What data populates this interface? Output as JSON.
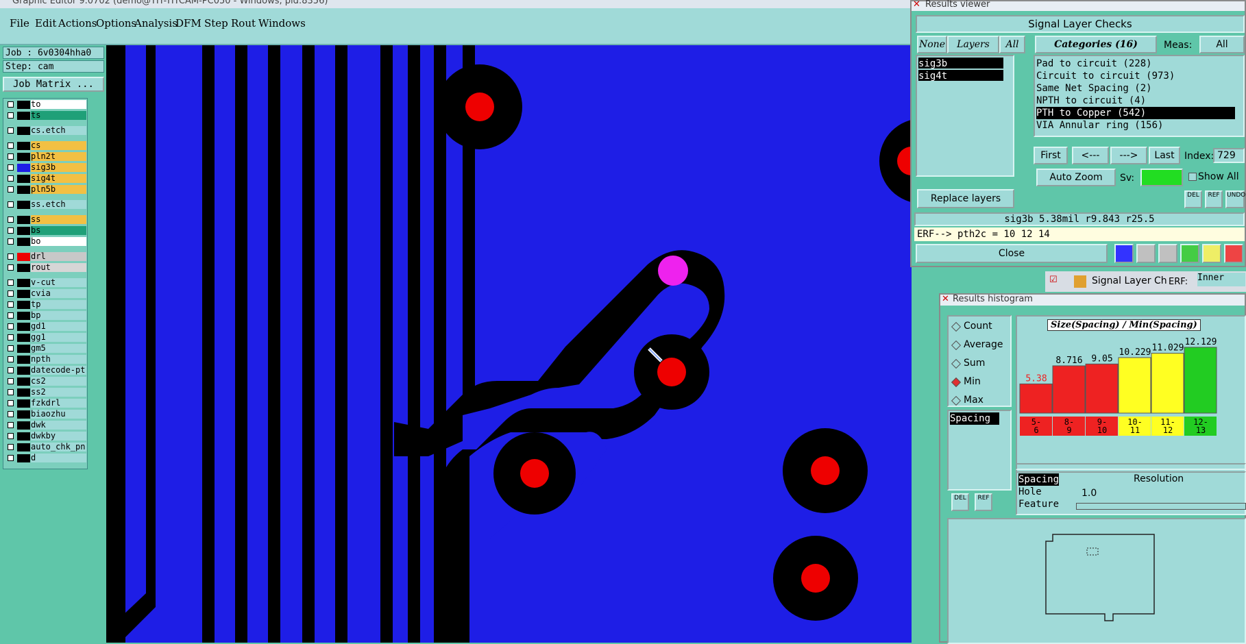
{
  "window": {
    "title": "Graphic Editor 9.0702 (demo@TIT-TITCAM-PC050 - Windows, pid:8356)"
  },
  "menu": [
    "File",
    "Edit",
    "Actions",
    "Options",
    "Analysis",
    "DFM",
    "Step",
    "Rout",
    "Windows"
  ],
  "job": {
    "job_label": "Job : 6v0304hha0",
    "step_label": "Step: cam",
    "matrix_button": "Job Matrix ..."
  },
  "layers": [
    {
      "name": "to",
      "color": "#000000",
      "bg": "#ffffff",
      "mark": "✎"
    },
    {
      "name": "ts",
      "color": "#000000",
      "bg": "#1fa078",
      "mark": ""
    },
    {
      "name": "cs.etch",
      "color": "#000000",
      "bg": "#a0dad8",
      "mark": ""
    },
    {
      "name": "cs",
      "color": "#000000",
      "bg": "#f2c044",
      "mark": ""
    },
    {
      "name": "pln2t",
      "color": "#000000",
      "bg": "#f2c044",
      "mark": ""
    },
    {
      "name": "sig3b",
      "color": "#1e1ee6",
      "bg": "#f2c044",
      "mark": "■"
    },
    {
      "name": "sig4t",
      "color": "#000000",
      "bg": "#f2c044",
      "mark": ""
    },
    {
      "name": "pln5b",
      "color": "#000000",
      "bg": "#f2c044",
      "mark": ""
    },
    {
      "name": "ss.etch",
      "color": "#000000",
      "bg": "#a0dad8",
      "mark": ""
    },
    {
      "name": "ss",
      "color": "#000000",
      "bg": "#f2c044",
      "mark": ""
    },
    {
      "name": "bs",
      "color": "#000000",
      "bg": "#1fa078",
      "mark": ""
    },
    {
      "name": "bo",
      "color": "#000000",
      "bg": "#ffffff",
      "mark": "✎"
    },
    {
      "name": "drl",
      "color": "#ee0000",
      "bg": "#c8c8c8",
      "mark": ""
    },
    {
      "name": "rout",
      "color": "#000000",
      "bg": "#d6d6d6",
      "mark": ""
    },
    {
      "name": "v-cut",
      "color": "#000000",
      "bg": "#a0dad8",
      "mark": ""
    },
    {
      "name": "cvia",
      "color": "#000000",
      "bg": "#a0dad8",
      "mark": ""
    },
    {
      "name": "tp",
      "color": "#000000",
      "bg": "#a0dad8",
      "mark": ""
    },
    {
      "name": "bp",
      "color": "#000000",
      "bg": "#a0dad8",
      "mark": ""
    },
    {
      "name": "gd1",
      "color": "#000000",
      "bg": "#a0dad8",
      "mark": "✎"
    },
    {
      "name": "gg1",
      "color": "#000000",
      "bg": "#a0dad8",
      "mark": ""
    },
    {
      "name": "gm5",
      "color": "#000000",
      "bg": "#a0dad8",
      "mark": "✎"
    },
    {
      "name": "npth",
      "color": "#000000",
      "bg": "#a0dad8",
      "mark": ""
    },
    {
      "name": "datecode-pt",
      "color": "#000000",
      "bg": "#a0dad8",
      "mark": ""
    },
    {
      "name": "cs2",
      "color": "#000000",
      "bg": "#a0dad8",
      "mark": ""
    },
    {
      "name": "ss2",
      "color": "#000000",
      "bg": "#a0dad8",
      "mark": ""
    },
    {
      "name": "fzkdrl",
      "color": "#000000",
      "bg": "#a0dad8",
      "mark": ""
    },
    {
      "name": "biaozhu",
      "color": "#000000",
      "bg": "#a0dad8",
      "mark": ""
    },
    {
      "name": "dwk",
      "color": "#000000",
      "bg": "#a0dad8",
      "mark": ""
    },
    {
      "name": "dwkby",
      "color": "#000000",
      "bg": "#a0dad8",
      "mark": ""
    },
    {
      "name": "auto_chk_pn",
      "color": "#000000",
      "bg": "#a0dad8",
      "mark": ""
    },
    {
      "name": "d",
      "color": "#000000",
      "bg": "#a0dad8",
      "mark": ""
    }
  ],
  "results_viewer": {
    "title": "Results viewer",
    "header": "Signal Layer Checks",
    "btn_none": "None",
    "btn_layers": "Layers",
    "btn_all": "All",
    "layers": [
      "sig3b",
      "sig4t"
    ],
    "categories_label": "Categories (16)",
    "meas_label": "Meas:",
    "meas_value": "All",
    "categories": [
      "Pad to circuit (228)",
      "Circuit to circuit (973)",
      "Same Net Spacing (2)",
      "NPTH to circuit (4)",
      "PTH to Copper (542)",
      "VIA Annular ring (156)"
    ],
    "selected_category": "PTH to Copper (542)",
    "btn_first": "First",
    "btn_prev": "<---",
    "btn_next": "--->",
    "btn_last": "Last",
    "index_label": "Index:",
    "index_value": "729",
    "auto_zoom": "Auto Zoom",
    "sv_label": "Sv:",
    "show_all": "Show All",
    "replace_layers": "Replace layers",
    "del_label": "DEL",
    "ref_label": "REF",
    "undo_label": "UNDO",
    "status": "sig3b 5.38mil  r9.843  r25.5",
    "erf": "ERF--> pth2c = 10 12 14",
    "close": "Close"
  },
  "taskbar_tab": {
    "label": "Signal Layer Ch",
    "erf_label": "ERF:",
    "erf_value": "Inner"
  },
  "histogram": {
    "title": "Results histogram",
    "options": [
      "Count",
      "Average",
      "Sum",
      "Min",
      "Max"
    ],
    "selected_option": "Min",
    "list_item": "Spacing",
    "chart_label": "Size(Spacing) / Min(Spacing)",
    "resolution_label": "Resolution",
    "resolution_value": "1.0",
    "measure_list": [
      "Spacing",
      "Hole",
      "Feature"
    ],
    "del_label": "DEL",
    "ref_label": "REF"
  },
  "chart_data": {
    "type": "bar",
    "title": "Size(Spacing) / Min(Spacing)",
    "categories": [
      "5-6",
      "8-9",
      "9-10",
      "10-11",
      "11-12",
      "12-13"
    ],
    "category_labels": [
      [
        "5-",
        "6"
      ],
      [
        "8-",
        "9"
      ],
      [
        "9-",
        "10"
      ],
      [
        "10-",
        "11"
      ],
      [
        "11-",
        "12"
      ],
      [
        "12-",
        "13"
      ]
    ],
    "values": [
      5.38,
      8.716,
      9.05,
      10.229,
      11.029,
      12.129
    ],
    "value_labels": [
      "5.38",
      "8.716",
      "9.05",
      "10.229",
      "11.029",
      "12.129"
    ],
    "colors": [
      "#ee2222",
      "#ee2222",
      "#ee2222",
      "#ffff22",
      "#ffff22",
      "#22cc22"
    ],
    "ylim": [
      0,
      13
    ]
  },
  "colors": {
    "copper": "#1e1ee6",
    "pad": "#ee0000",
    "highlight_pad": "#ee22ee",
    "ui_bg": "#5fc6a9",
    "ui_panel": "#a0dad8"
  }
}
